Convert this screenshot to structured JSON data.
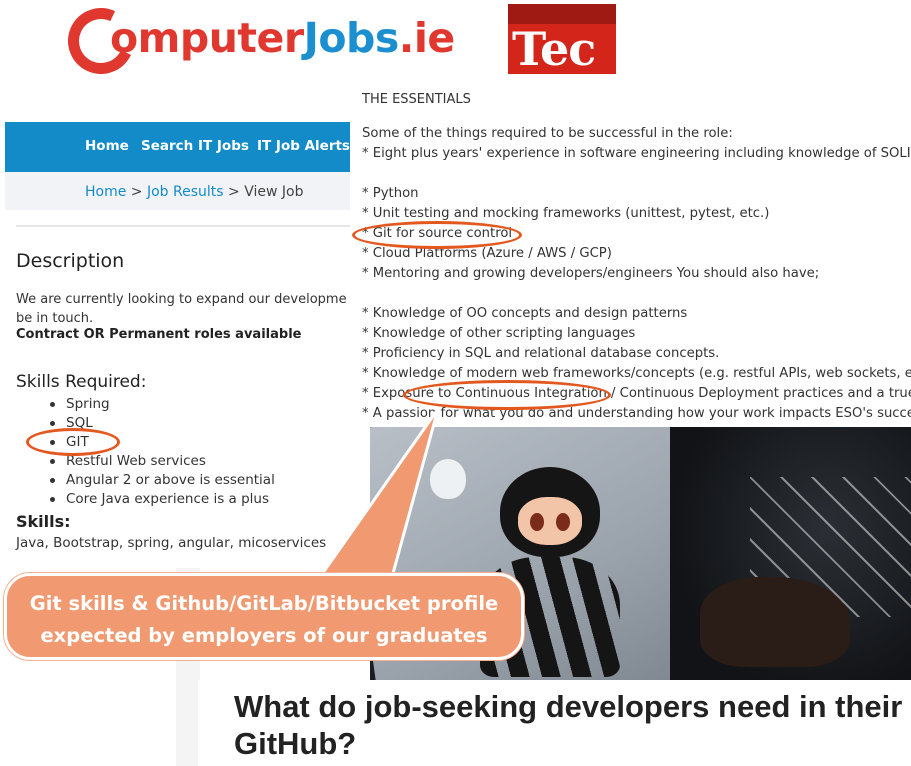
{
  "logos": {
    "computerjobs": {
      "part1": "omputer",
      "part2": "Jobs",
      "part3": ".ie"
    },
    "tech": {
      "text": "Tec"
    }
  },
  "job_listing": {
    "nav": [
      "Home",
      "Search IT Jobs",
      "IT Job Alerts"
    ],
    "breadcrumb": {
      "home": "Home",
      "sep1": " > ",
      "results": "Job Results",
      "sep2": " > ",
      "current": "View Job"
    },
    "description_title": "Description",
    "description_text": "We are currently looking to expand our developme be in touch.",
    "description_bold": "Contract OR Permanent roles available",
    "skills_required_title": "Skills Required:",
    "skills_required": [
      "Spring",
      "SQL",
      "GIT",
      "Restful Web services",
      "Angular 2 or above is essential",
      "Core Java experience is a plus"
    ],
    "skills_title": "Skills:",
    "skills_text": "Java, Bootstrap, spring, angular, micoservices"
  },
  "essentials": {
    "title": "THE ESSENTIALS",
    "lines": [
      "Some of the things required to be successful in the role:",
      "* Eight plus years' experience in software engineering including knowledge of SOLID, D",
      "* Python",
      "* Unit testing and mocking frameworks (unittest, pytest, etc.)",
      "* Git for source control",
      "* Cloud Platforms (Azure / AWS / GCP)",
      "* Mentoring and growing developers/engineers You should also have;",
      "* Knowledge of OO concepts and design patterns",
      "* Knowledge of other scripting languages",
      "* Proficiency in SQL and relational database concepts.",
      "* Knowledge of modern web frameworks/concepts (e.g. restful APIs, web sockets, etc.",
      "* Exposure to Continuous Integration / Continuous Deployment practices and a true D",
      "* A passion for what you do and understanding how your work impacts ESO's success"
    ]
  },
  "callout": {
    "line1": "Git skills & Github/GitLab/Bitbucket profile",
    "line2": "expected by employers of our graduates"
  },
  "article": {
    "title": "What do job-seeking developers need in their GitHub?"
  },
  "colors": {
    "brand_red": "#e0382f",
    "brand_blue": "#1b8fd0",
    "nav_blue": "#138bc9",
    "highlight_orange": "#e2581f",
    "callout_fill": "#f19a72"
  }
}
